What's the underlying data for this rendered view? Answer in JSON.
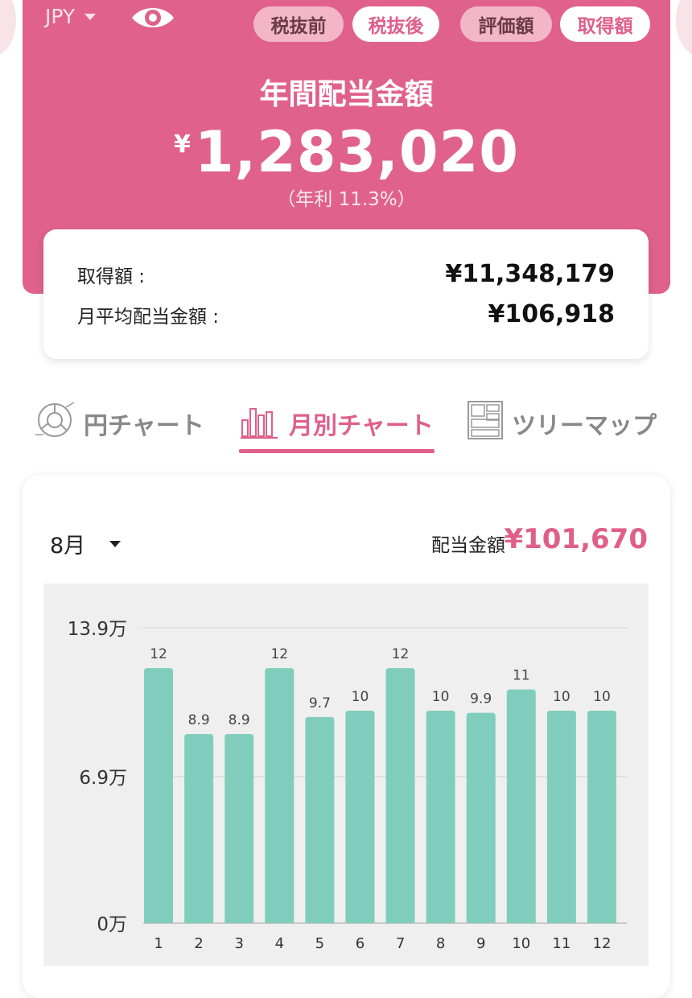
{
  "header": {
    "currency": "JPY",
    "toggles": [
      {
        "label": "税抜前",
        "active": false
      },
      {
        "label": "税抜後",
        "active": true
      },
      {
        "label": "評価額",
        "active": false
      },
      {
        "label": "取得額",
        "active": true
      }
    ],
    "title": "年間配当金額",
    "amount_yen": "¥",
    "amount_value": "1,283,020",
    "yield_text": "（年利 11.3%）"
  },
  "summary": {
    "acquisition_label": "取得額 :",
    "acquisition_value": "¥11,348,179",
    "monthly_avg_label": "月平均配当金額 :",
    "monthly_avg_value": "¥106,918"
  },
  "tabs": [
    {
      "label": "円チャート",
      "icon": "pie-chart-icon",
      "active": false
    },
    {
      "label": "月別チャート",
      "icon": "bar-chart-icon",
      "active": true
    },
    {
      "label": "ツリーマップ",
      "icon": "treemap-icon",
      "active": false
    }
  ],
  "monthly": {
    "selected_month": "8月",
    "dividend_label": "配当金額",
    "dividend_value": "¥101,670"
  },
  "colors": {
    "brand_pink": "#df5f8a",
    "bar_teal": "#81cdbd",
    "chart_bg": "#efefef"
  },
  "chart_data": {
    "type": "bar",
    "categories": [
      "1",
      "2",
      "3",
      "4",
      "5",
      "6",
      "7",
      "8",
      "9",
      "10",
      "11",
      "12"
    ],
    "values": [
      12,
      8.9,
      8.9,
      12,
      9.7,
      10,
      12,
      10,
      9.9,
      11,
      10,
      10
    ],
    "data_labels": [
      "12",
      "8.9",
      "8.9",
      "12",
      "9.7",
      "10",
      "12",
      "10",
      "9.9",
      "11",
      "10",
      "10"
    ],
    "y_ticks": [
      {
        "value": 0,
        "label": "0万"
      },
      {
        "value": 6.9,
        "label": "6.9万"
      },
      {
        "value": 13.9,
        "label": "13.9万"
      }
    ],
    "ylim": [
      0,
      13.9
    ],
    "grid": true,
    "title": "",
    "xlabel": "",
    "ylabel": ""
  }
}
